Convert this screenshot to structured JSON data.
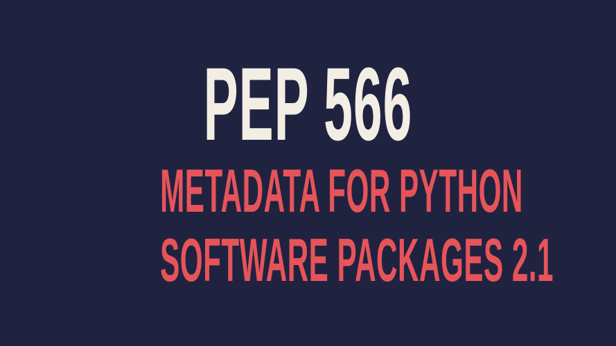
{
  "slide": {
    "title": "PEP 566",
    "subtitle_line1": "METADATA FOR PYTHON",
    "subtitle_line2": "SOFTWARE PACKAGES 2.1"
  },
  "colors": {
    "background": "#202340",
    "title": "#F3EEE4",
    "subtitle": "#E6545A"
  }
}
